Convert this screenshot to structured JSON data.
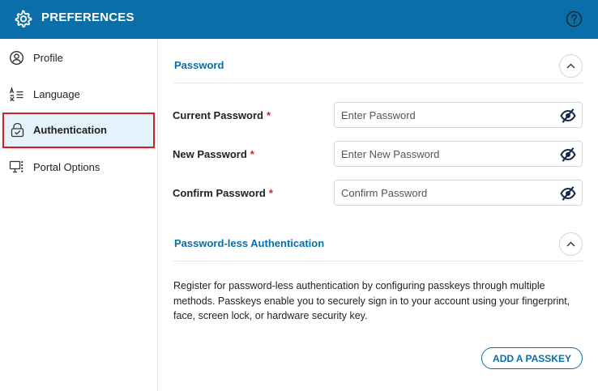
{
  "app": {
    "title": "PREFERENCES",
    "settings_icon": "gear-icon",
    "help_icon": "help-circle-icon",
    "brand_color": "#0a6fa8"
  },
  "sidebar": {
    "items": [
      {
        "label": "Profile",
        "icon": "user-circle-icon"
      },
      {
        "label": "Language",
        "icon": "translate-icon"
      },
      {
        "label": "Authentication",
        "icon": "lock-icon",
        "active": true
      },
      {
        "label": "Portal Options",
        "icon": "monitor-icon"
      }
    ]
  },
  "password_section": {
    "title": "Password",
    "fields": [
      {
        "label": "Current Password",
        "required_mark": "*",
        "placeholder": "Enter Password",
        "value": ""
      },
      {
        "label": "New Password",
        "required_mark": "*",
        "placeholder": "Enter New Password",
        "value": ""
      },
      {
        "label": "Confirm Password",
        "required_mark": "*",
        "placeholder": "Confirm Password",
        "value": ""
      }
    ]
  },
  "passwordless_section": {
    "title": "Password-less Authentication",
    "description": "Register for password-less authentication by configuring passkeys through multiple methods. Passkeys enable you to securely sign in to your account using your fingerprint, face, screen lock, or hardware security key.",
    "add_button_label": "ADD A PASSKEY"
  }
}
